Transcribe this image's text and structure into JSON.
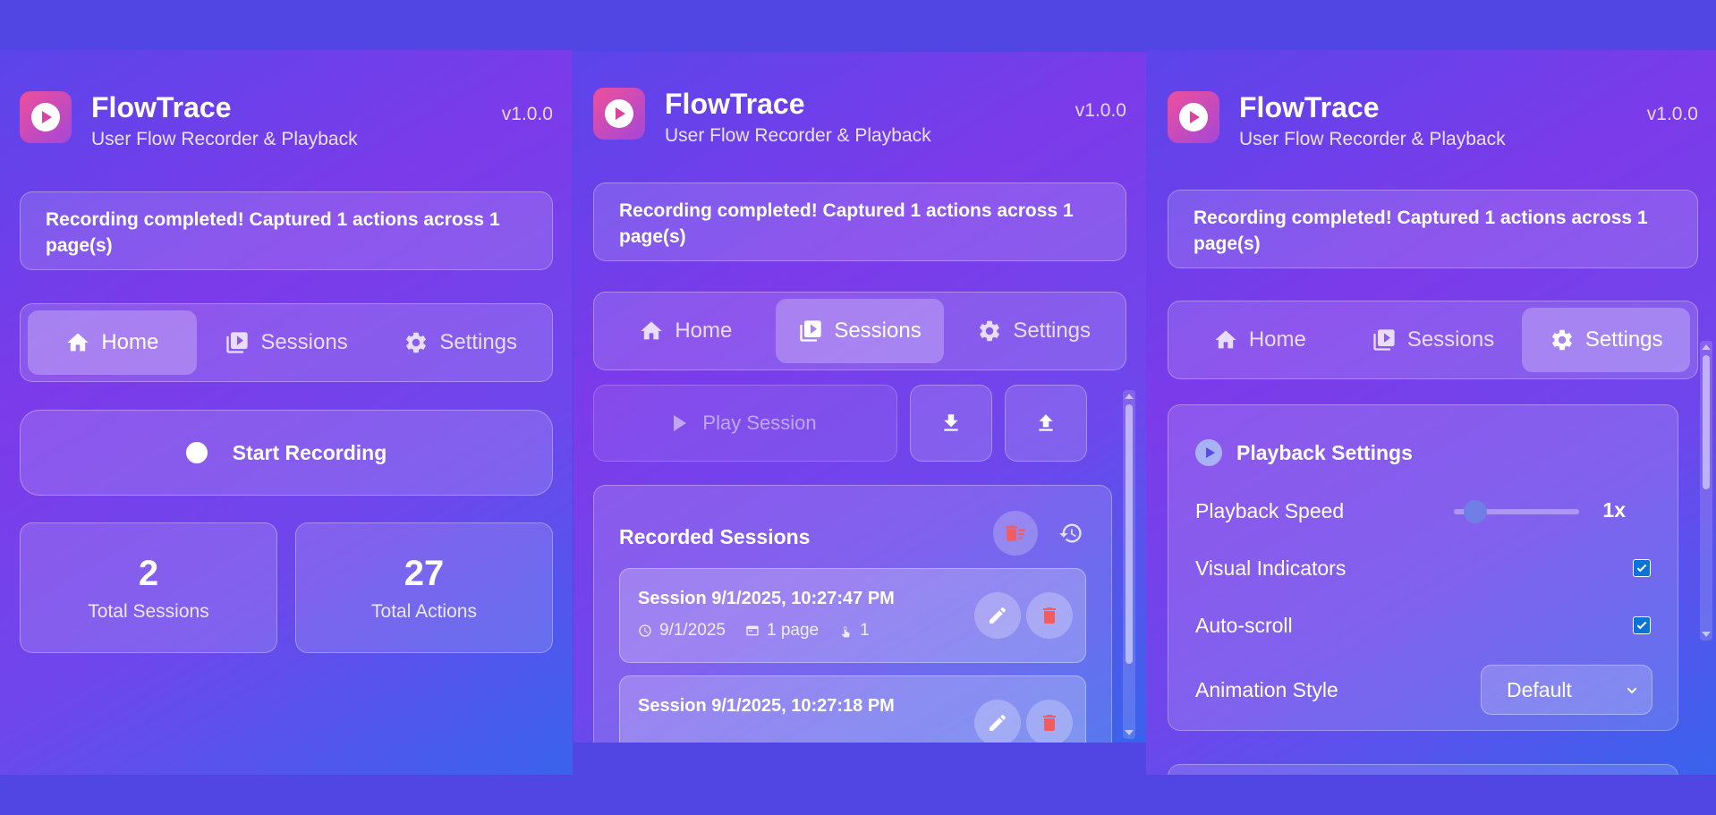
{
  "app": {
    "title": "FlowTrace",
    "subtitle": "User Flow Recorder & Playback",
    "version": "v1.0.0"
  },
  "status_message": "Recording completed! Captured 1 actions across 1 page(s)",
  "tabs": {
    "home": "Home",
    "sessions": "Sessions",
    "settings": "Settings"
  },
  "home": {
    "record_button": "Start Recording",
    "stats": {
      "sessions_value": "2",
      "sessions_label": "Total Sessions",
      "actions_value": "27",
      "actions_label": "Total Actions"
    }
  },
  "sessions": {
    "play_button": "Play Session",
    "list_title": "Recorded Sessions",
    "items": [
      {
        "name": "Session 9/1/2025, 10:27:47 PM",
        "date": "9/1/2025",
        "pages": "1 page",
        "actions": "1"
      },
      {
        "name": "Session 9/1/2025, 10:27:18 PM"
      }
    ]
  },
  "settings": {
    "section_title": "Playback Settings",
    "speed_label": "Playback Speed",
    "speed_value": "1x",
    "speed_level": 0.1,
    "visual_label": "Visual Indicators",
    "visual_checked": true,
    "autoscroll_label": "Auto-scroll",
    "autoscroll_checked": true,
    "animation_label": "Animation Style",
    "animation_value": "Default"
  },
  "icons": {
    "logo": "play-icon",
    "home": "home-icon",
    "sessions": "video-library-icon",
    "settings": "gear-icon",
    "download": "download-icon",
    "upload": "upload-icon",
    "clear": "clear-all-icon",
    "history": "history-icon",
    "edit": "pencil-icon",
    "delete": "trash-icon"
  },
  "colors": {
    "accent_red": "#f25c5c",
    "checkbox_blue": "#0b72d8"
  }
}
